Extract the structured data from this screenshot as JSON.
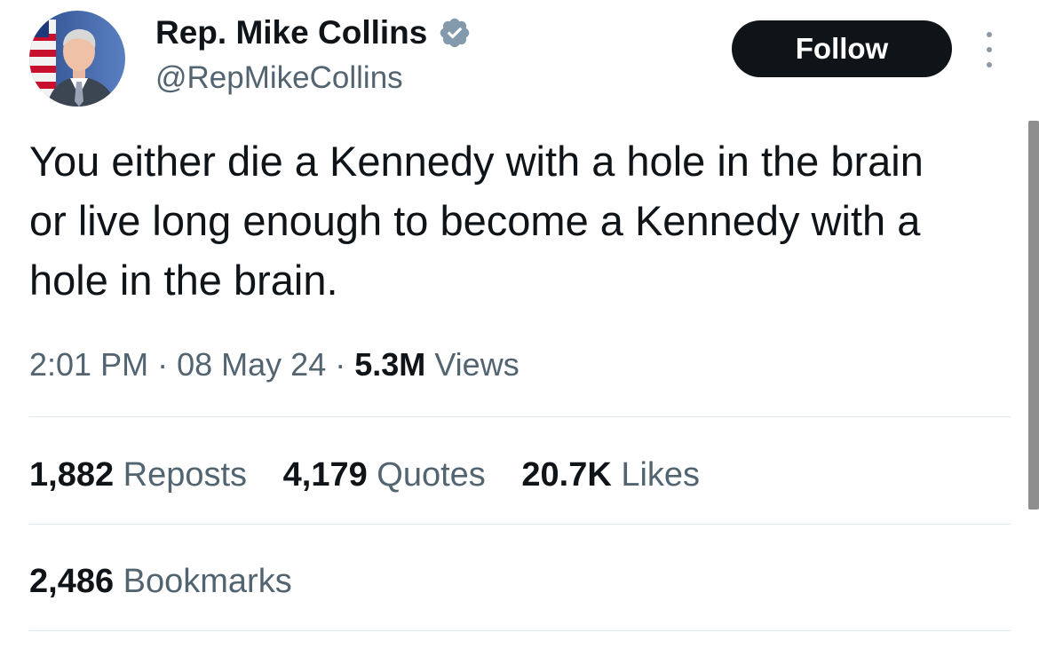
{
  "author": {
    "display_name": "Rep. Mike Collins",
    "handle": "@RepMikeCollins",
    "avatar_icon": "profile-photo",
    "verified_icon": "verified-badge-icon",
    "verified_color": "#829aab"
  },
  "actions": {
    "follow_label": "Follow",
    "more_icon": "more-vertical-icon"
  },
  "tweet": {
    "text": "You either die a Kennedy with a hole in the brain or live long enough to become a Kennedy with a hole in the brain."
  },
  "meta": {
    "time": "2:01 PM",
    "separator": "·",
    "date": "08 May 24",
    "views_count": "5.3M",
    "views_label": "Views"
  },
  "stats": {
    "reposts_count": "1,882",
    "reposts_label": "Reposts",
    "quotes_count": "4,179",
    "quotes_label": "Quotes",
    "likes_count": "20.7K",
    "likes_label": "Likes",
    "bookmarks_count": "2,486",
    "bookmarks_label": "Bookmarks"
  },
  "colors": {
    "text_primary": "#0f1419",
    "text_secondary": "#536471",
    "follow_bg": "#0f1419",
    "divider": "#e1e8ed"
  }
}
